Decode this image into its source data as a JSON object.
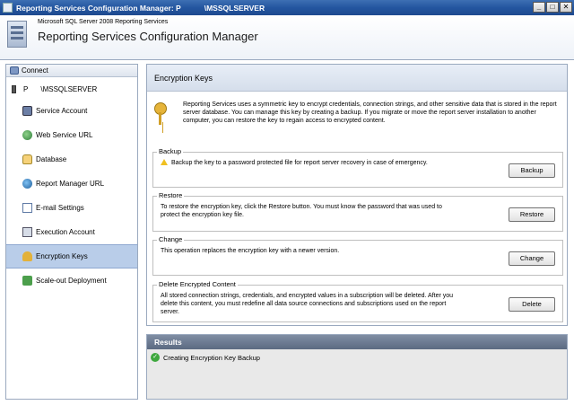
{
  "window": {
    "title": "Reporting Services Configuration Manager: P",
    "server": "\\MSSQLSERVER",
    "minimize_glyph": "_",
    "maximize_glyph": "□",
    "close_glyph": "✕"
  },
  "header": {
    "product": "Microsoft SQL Server 2008 Reporting Services",
    "title": "Reporting Services Configuration Manager"
  },
  "sidebar": {
    "connect_label": "Connect",
    "server_name": "P",
    "instance_name": "\\MSSQLSERVER",
    "items": [
      {
        "label": "Service Account",
        "icon": "service-account-icon"
      },
      {
        "label": "Web Service URL",
        "icon": "web-service-icon"
      },
      {
        "label": "Database",
        "icon": "database-icon"
      },
      {
        "label": "Report Manager URL",
        "icon": "report-manager-icon"
      },
      {
        "label": "E-mail Settings",
        "icon": "email-icon"
      },
      {
        "label": "Execution Account",
        "icon": "execution-account-icon"
      },
      {
        "label": "Encryption Keys",
        "icon": "encryption-keys-icon"
      },
      {
        "label": "Scale-out Deployment",
        "icon": "scale-out-icon"
      }
    ],
    "active_item": "Encryption Keys"
  },
  "main": {
    "heading": "Encryption Keys",
    "intro": "Reporting Services uses a symmetric key to encrypt credentials, connection strings, and other sensitive data that is stored in the report server database. You can manage this key by creating a backup. If you migrate or move the report server installation to another computer, you can restore the key to regain access to encrypted content.",
    "backup": {
      "legend": "Backup",
      "description": "Backup the key to a password protected file for report server recovery in case of emergency.",
      "button": "Backup"
    },
    "restore": {
      "legend": "Restore",
      "description": "To restore the encryption key, click the Restore button. You must know the password that was used to protect the encryption key file.",
      "button": "Restore"
    },
    "change": {
      "legend": "Change",
      "description": "This operation replaces the encryption key with a newer version.",
      "button": "Change"
    },
    "delete": {
      "legend": "Delete Encrypted Content",
      "description": "All stored connection strings, credentials, and encrypted values in a subscription will be deleted. After you delete this content, you must redefine all data source connections and subscriptions used on the report server.",
      "button": "Delete"
    }
  },
  "results": {
    "heading": "Results",
    "message": "Creating Encryption Key Backup",
    "status_glyph": "✓"
  }
}
